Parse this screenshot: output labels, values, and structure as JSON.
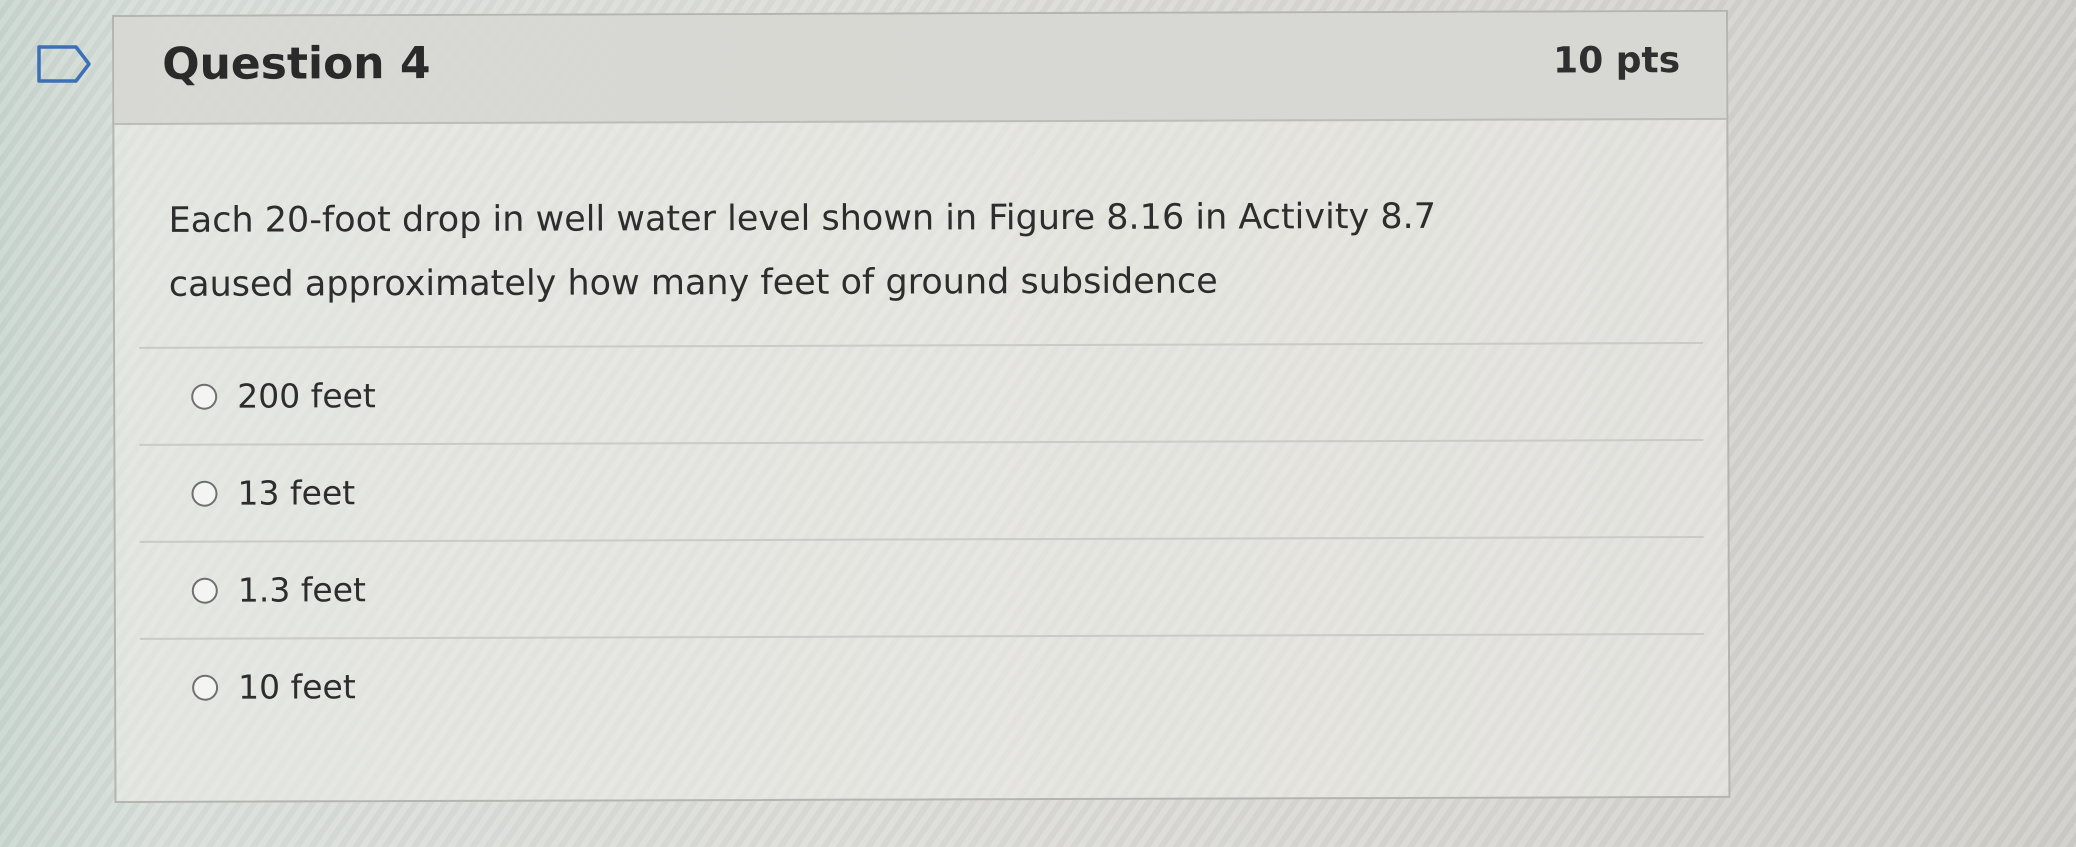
{
  "question": {
    "flag_icon": "flag-outline-icon",
    "title": "Question 4",
    "points": "10 pts",
    "text": "Each 20-foot drop in well water level shown in Figure 8.16 in Activity 8.7 caused approximately how many feet of ground subsidence",
    "answers": [
      {
        "label": "200 feet",
        "selected": false
      },
      {
        "label": "13 feet",
        "selected": false
      },
      {
        "label": "1.3 feet",
        "selected": false
      },
      {
        "label": "10 feet",
        "selected": false
      }
    ]
  }
}
